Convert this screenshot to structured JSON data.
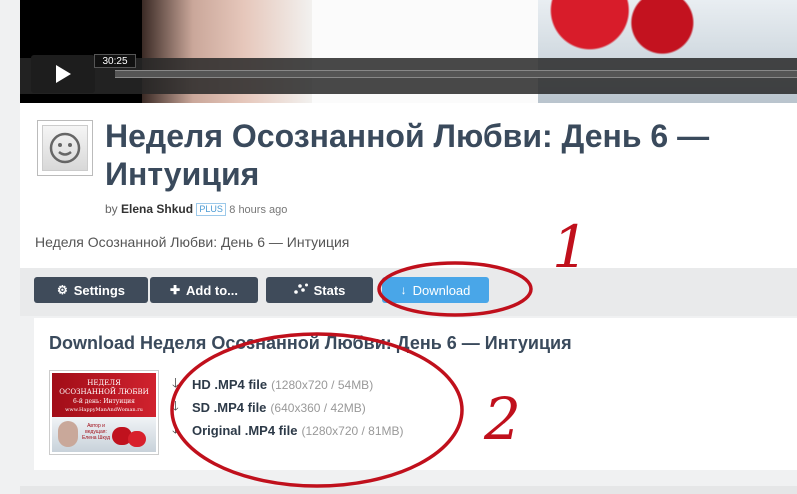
{
  "player": {
    "timecode": "30:25",
    "progress": 0.0
  },
  "header": {
    "title": "Неделя Осознанной Любви: День 6 — Интуиция",
    "by": "by",
    "author": "Elena Shkud",
    "badge": "PLUS",
    "ago": "8 hours ago",
    "description": "Неделя Осознанной Любви: День 6 — Интуиция"
  },
  "toolbar": {
    "settings_label": "Settings",
    "addto_label": "Add to...",
    "stats_label": "Stats",
    "download_label": "Download"
  },
  "download_panel": {
    "title": "Download Неделя Осознанной Любви: День 6 — Интуиция",
    "thumbnail_text": {
      "line1": "НЕДЕЛЯ",
      "line2": "ОСОЗНАННОЙ ЛЮБВИ",
      "line3": "6-й день: Интуиция",
      "line4": "www.HappyManAndWoman.ru",
      "line5": "Автор и ведущая: Елена Шкуд"
    },
    "files": [
      {
        "name": "HD .MP4 file",
        "meta": "(1280x720 / 54MB)"
      },
      {
        "name": "SD .MP4 file",
        "meta": "(640x360 / 42MB)"
      },
      {
        "name": "Original .MP4 file",
        "meta": "(1280x720 / 81MB)"
      }
    ]
  },
  "annotations": {
    "label1": "1",
    "label2": "2",
    "color": "#c0101c"
  },
  "colors": {
    "download_button": "#49a6e8",
    "dark_button": "#3f4b5a",
    "title_text": "#3a4a5c"
  }
}
